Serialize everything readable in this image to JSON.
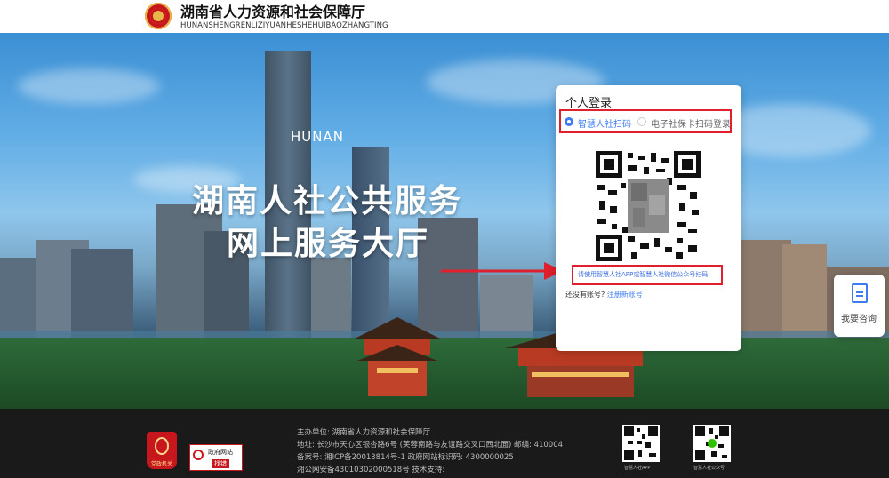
{
  "header": {
    "title": "湖南省人力资源和社会保障厅",
    "subtitle": "HUNANSHENGRENLIZIYUANHESHEHUIBAOZHANGTING"
  },
  "hero": {
    "kicker": "HUNAN",
    "title_line1": "湖南人社公共服务",
    "title_line2": "网上服务大厅"
  },
  "login": {
    "title": "个人登录",
    "tabs": [
      {
        "label": "智慧人社扫码",
        "selected": true
      },
      {
        "label": "电子社保卡扫码登录",
        "selected": false
      }
    ],
    "qr_hint": "请使用智慧人社APP或智慧人社微信公众号扫码",
    "no_account_text": "还没有账号?",
    "register_link": "注册新账号"
  },
  "consult": {
    "label": "我要咨询",
    "icon": "document-icon"
  },
  "footer": {
    "badge_party": "党政机关",
    "badge_gov_top": "政府网站",
    "badge_gov_bottom": "找错",
    "lines": [
      "主办单位: 湖南省人力资源和社会保障厅",
      "地址: 长沙市天心区银杏路6号 (芙蓉南路与友谊路交叉口西北面)   邮编: 410004",
      "备案号: 湘ICP备20013814号-1 政府网站标识码: 4300000025",
      "湘公网安备43010302000518号 技术支持:"
    ],
    "qr_codes": [
      {
        "label": "智慧人社APP"
      },
      {
        "label": "智慧人社公众号"
      }
    ]
  },
  "colors": {
    "accent": "#3d7cf5",
    "highlight_border": "#e0202c",
    "brand_red": "#c8161d",
    "footer_bg": "#1a1a1a"
  }
}
